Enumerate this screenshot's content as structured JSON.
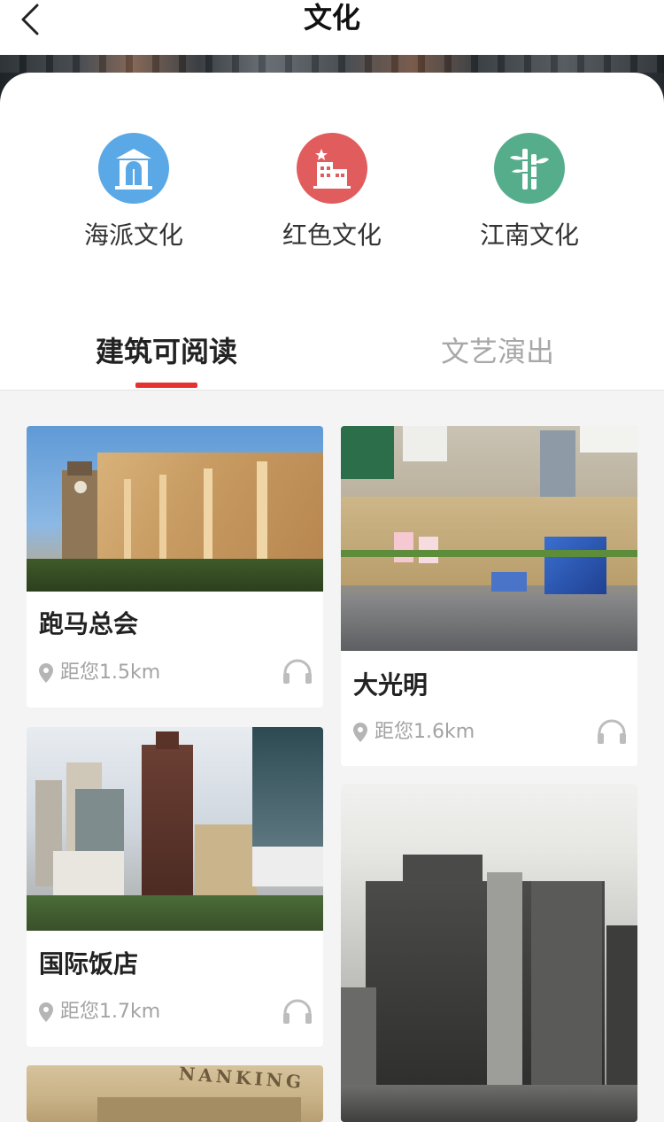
{
  "header": {
    "title": "文化"
  },
  "categories": [
    {
      "label": "海派文化",
      "icon": "building-door-icon",
      "color": "#5aa9e6"
    },
    {
      "label": "红色文化",
      "icon": "building-star-icon",
      "color": "#e15d5d"
    },
    {
      "label": "江南文化",
      "icon": "bamboo-icon",
      "color": "#56ad8c"
    }
  ],
  "tabs": [
    {
      "label": "建筑可阅读",
      "active": true
    },
    {
      "label": "文艺演出",
      "active": false
    }
  ],
  "accent_color": "#e6322e",
  "cards": [
    {
      "name": "跑马总会",
      "distance": "距您1.5km"
    },
    {
      "name": "大光明",
      "distance": "距您1.6km"
    },
    {
      "name": "国际饭店",
      "distance": "距您1.7km"
    },
    {
      "name": "",
      "distance": ""
    },
    {
      "name": "",
      "distance": ""
    }
  ],
  "photo_texts": {
    "nanking_sign": "NANKING"
  }
}
